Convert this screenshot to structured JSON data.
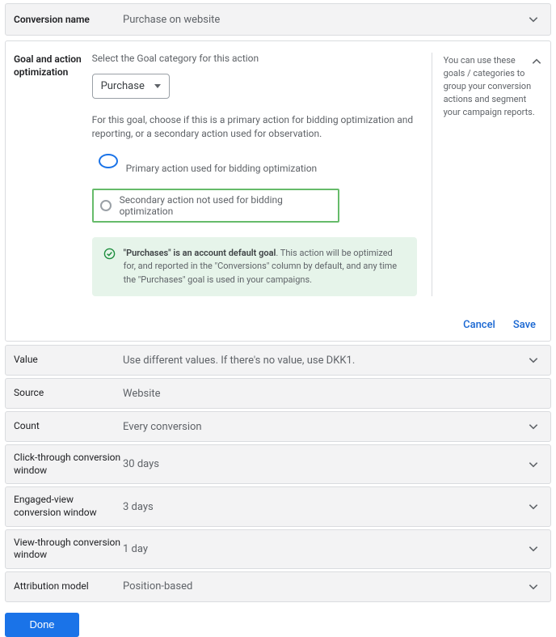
{
  "header": {
    "label": "Conversion name",
    "value": "Purchase on website"
  },
  "goal": {
    "label": "Goal and action optimization",
    "intro": "Select the Goal category for this action",
    "select_value": "Purchase",
    "desc": "For this goal, choose if this is a primary action for bidding optimization and reporting, or a secondary action used for observation.",
    "radio_primary": "Primary action used for bidding optimization",
    "radio_secondary": "Secondary action not used for bidding optimization",
    "tip_bold": "\"Purchases\" is an account default goal",
    "tip_rest": ". This action will be optimized for, and reported in the \"Conversions\" column by default, and any time the \"Purchases\" goal is used in your campaigns.",
    "help": "You can use these goals / categories to group your conversion actions and segment your campaign reports."
  },
  "actions": {
    "cancel": "Cancel",
    "save": "Save"
  },
  "rows": [
    {
      "label": "Value",
      "value": "Use different values. If there's no value, use DKK1.",
      "expandable": true
    },
    {
      "label": "Source",
      "value": "Website",
      "expandable": false
    },
    {
      "label": "Count",
      "value": "Every conversion",
      "expandable": true
    },
    {
      "label": "Click-through conversion window",
      "value": "30 days",
      "expandable": true
    },
    {
      "label": "Engaged-view conversion window",
      "value": "3 days",
      "expandable": true
    },
    {
      "label": "View-through conversion window",
      "value": "1 day",
      "expandable": true
    },
    {
      "label": "Attribution model",
      "value": "Position-based",
      "expandable": true
    }
  ],
  "done": "Done"
}
